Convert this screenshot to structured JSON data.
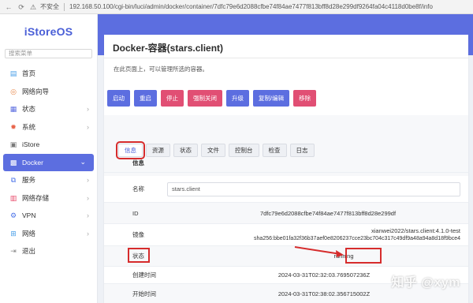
{
  "browser": {
    "security_label": "不安全",
    "url": "192.168.50.100/cgi-bin/luci/admin/docker/container/7dfc79e6d2088cfbe74f84ae7477f813bff8d28e299df9264fa04c4118d0be8f/info"
  },
  "sidebar": {
    "brand": "iStoreOS",
    "search_placeholder": "搜索菜单",
    "items": [
      {
        "label": "首页",
        "icon": "home-icon"
      },
      {
        "label": "网络向导",
        "icon": "wizard-icon"
      },
      {
        "label": "状态",
        "icon": "status-icon",
        "expandable": true
      },
      {
        "label": "系统",
        "icon": "system-gear-icon",
        "expandable": true
      },
      {
        "label": "iStore",
        "icon": "store-icon"
      },
      {
        "label": "Docker",
        "icon": "docker-icon",
        "expandable": true,
        "active": true
      },
      {
        "label": "服务",
        "icon": "services-icon",
        "expandable": true
      },
      {
        "label": "网络存储",
        "icon": "storage-icon",
        "expandable": true
      },
      {
        "label": "VPN",
        "icon": "vpn-icon",
        "expandable": true
      },
      {
        "label": "网络",
        "icon": "network-icon",
        "expandable": true
      },
      {
        "label": "退出",
        "icon": "logout-icon"
      }
    ]
  },
  "main": {
    "title": "Docker-容器(stars.client)",
    "description": "在此页面上，可以管理所选的容器。",
    "actions": [
      {
        "label": "启动",
        "style": "blue"
      },
      {
        "label": "重启",
        "style": "blue"
      },
      {
        "label": "停止",
        "style": "red"
      },
      {
        "label": "强制关闭",
        "style": "red"
      },
      {
        "label": "升级",
        "style": "blue"
      },
      {
        "label": "复制/编辑",
        "style": "blue"
      },
      {
        "label": "移除",
        "style": "red"
      }
    ],
    "tabs": [
      {
        "label": "信息",
        "active": true
      },
      {
        "label": "资源"
      },
      {
        "label": "状态"
      },
      {
        "label": "文件"
      },
      {
        "label": "控制台"
      },
      {
        "label": "检查"
      },
      {
        "label": "日志"
      }
    ],
    "info": {
      "section_label": "信息",
      "name_label": "名称",
      "name_value": "stars.client",
      "id_label": "ID",
      "id_value": "7dfc79e6d2088cfbe74f84ae7477f813bff8d28e299df",
      "image_label": "镜像",
      "image_line1": "xianwei2022/stars.client:4.1.0-test",
      "image_line2": "sha256:bbe01fa32f36b37aef0e8206237cce23bc704c317c49df9a48a94a8d18f9bce4",
      "status_label": "状态",
      "status_value": "running",
      "created_label": "创建时间",
      "created_value": "2024-03-31T02:32:03.769507236Z",
      "started_label": "开始时间",
      "started_value": "2024-03-31T02:38:02.356715002Z"
    }
  },
  "watermark": "知乎 @xym",
  "colors": {
    "accent": "#5c6ee0",
    "danger": "#e14f74",
    "highlight": "#d62c2c"
  }
}
